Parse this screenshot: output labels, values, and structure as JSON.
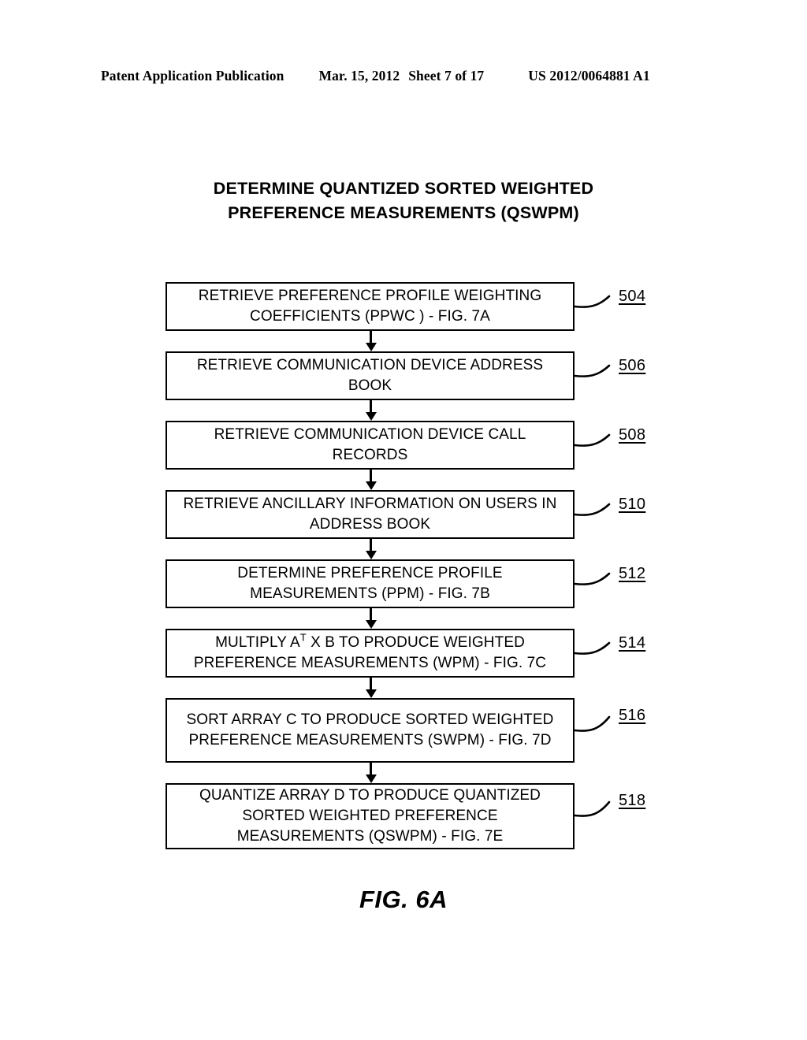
{
  "header": {
    "publication": "Patent Application Publication",
    "date": "Mar. 15, 2012",
    "sheet": "Sheet 7 of 17",
    "patent_number": "US 2012/0064881 A1"
  },
  "figure": {
    "title_line1": "DETERMINE QUANTIZED SORTED WEIGHTED",
    "title_line2": "PREFERENCE MEASUREMENTS (QSWPM)",
    "caption": "FIG. 6A"
  },
  "flowchart": {
    "type": "flowchart",
    "orientation": "vertical",
    "nodes": [
      {
        "ref": "504",
        "lines": [
          "RETRIEVE PREFERENCE PROFILE WEIGHTING",
          "COEFFICIENTS (PPWC ) - FIG. 7A"
        ],
        "text": "RETRIEVE PREFERENCE PROFILE WEIGHTING COEFFICIENTS (PPWC ) - FIG. 7A"
      },
      {
        "ref": "506",
        "lines": [
          "RETRIEVE COMMUNICATION DEVICE ADDRESS",
          "BOOK"
        ],
        "text": "RETRIEVE COMMUNICATION DEVICE ADDRESS BOOK"
      },
      {
        "ref": "508",
        "lines": [
          "RETRIEVE COMMUNICATION DEVICE CALL",
          "RECORDS"
        ],
        "text": "RETRIEVE COMMUNICATION DEVICE CALL RECORDS"
      },
      {
        "ref": "510",
        "lines": [
          "RETRIEVE ANCILLARY INFORMATION ON USERS IN",
          "ADDRESS BOOK"
        ],
        "text": "RETRIEVE ANCILLARY INFORMATION ON USERS IN ADDRESS BOOK"
      },
      {
        "ref": "512",
        "lines": [
          "DETERMINE PREFERENCE PROFILE",
          "MEASUREMENTS (PPM) - FIG. 7B"
        ],
        "text": "DETERMINE PREFERENCE PROFILE MEASUREMENTS (PPM) - FIG. 7B"
      },
      {
        "ref": "514",
        "lines": [
          "MULTIPLY A^T X B TO PRODUCE WEIGHTED",
          "PREFERENCE MEASUREMENTS (WPM) - FIG. 7C"
        ],
        "text": "MULTIPLY A(T) X B TO PRODUCE WEIGHTED PREFERENCE MEASUREMENTS (WPM) - FIG. 7C",
        "part_a": "MULTIPLY A",
        "superscript": "T",
        "part_b": " X B TO PRODUCE WEIGHTED PREFERENCE MEASUREMENTS (WPM) - FIG. 7C"
      },
      {
        "ref": "516",
        "lines": [
          "SORT ARRAY C TO PRODUCE SORTED WEIGHTED",
          "PREFERENCE MEASUREMENTS (SWPM) - FIG. 7D"
        ],
        "text": "SORT ARRAY C TO PRODUCE SORTED WEIGHTED PREFERENCE MEASUREMENTS (SWPM) - FIG. 7D"
      },
      {
        "ref": "518",
        "lines": [
          "QUANTIZE ARRAY D TO PRODUCE QUANTIZED",
          "SORTED WEIGHTED PREFERENCE",
          "MEASUREMENTS (QSWPM) - FIG. 7E"
        ],
        "text": "QUANTIZE ARRAY D TO PRODUCE QUANTIZED SORTED WEIGHTED PREFERENCE MEASUREMENTS (QSWPM) - FIG. 7E"
      }
    ],
    "edges": [
      {
        "from": "504",
        "to": "506"
      },
      {
        "from": "506",
        "to": "508"
      },
      {
        "from": "508",
        "to": "510"
      },
      {
        "from": "510",
        "to": "512"
      },
      {
        "from": "512",
        "to": "514"
      },
      {
        "from": "514",
        "to": "516"
      },
      {
        "from": "516",
        "to": "518"
      }
    ],
    "colors": {
      "stroke": "#000000",
      "fill": "#ffffff"
    }
  }
}
